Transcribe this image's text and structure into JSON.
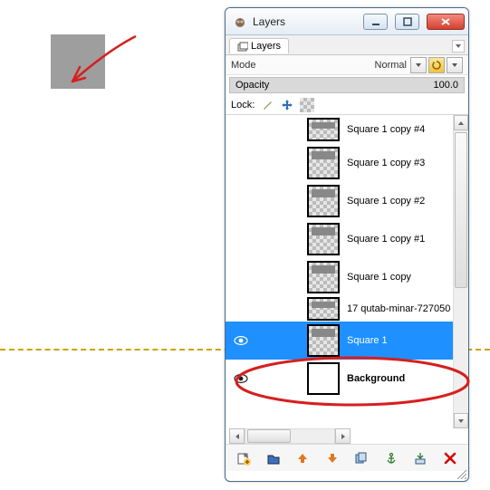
{
  "window": {
    "title": "Layers",
    "buttons": {
      "minimize": "min",
      "maximize": "max",
      "close": "close"
    }
  },
  "tab": {
    "label": "Layers"
  },
  "mode": {
    "label": "Mode",
    "value": "Normal"
  },
  "opacity": {
    "label": "Opacity",
    "value": "100.0"
  },
  "lock": {
    "label": "Lock:"
  },
  "layers": [
    {
      "name": "Square 1 copy #4",
      "eye": false,
      "thumb": "checker-short",
      "selected": false
    },
    {
      "name": "Square 1 copy #3",
      "eye": false,
      "thumb": "checker",
      "selected": false
    },
    {
      "name": "Square 1 copy #2",
      "eye": false,
      "thumb": "checker",
      "selected": false
    },
    {
      "name": "Square 1 copy #1",
      "eye": false,
      "thumb": "checker",
      "selected": false
    },
    {
      "name": "Square 1 copy",
      "eye": false,
      "thumb": "checker",
      "selected": false
    },
    {
      "name": "17 qutab-minar-727050",
      "eye": false,
      "thumb": "checker-short",
      "selected": false
    },
    {
      "name": "Square 1",
      "eye": true,
      "thumb": "checker",
      "selected": true
    },
    {
      "name": "Background",
      "eye": true,
      "thumb": "white",
      "selected": false,
      "bold": true
    }
  ],
  "toolbar_icons": [
    "new-layer-icon",
    "add-group-icon",
    "raise-layer-icon",
    "lower-layer-icon",
    "duplicate-layer-icon",
    "anchor-layer-icon",
    "merge-down-icon",
    "delete-layer-icon"
  ],
  "annotation": {
    "canvas_square": "grey-square",
    "arrow": "red-arrow",
    "oval": "red-oval"
  }
}
